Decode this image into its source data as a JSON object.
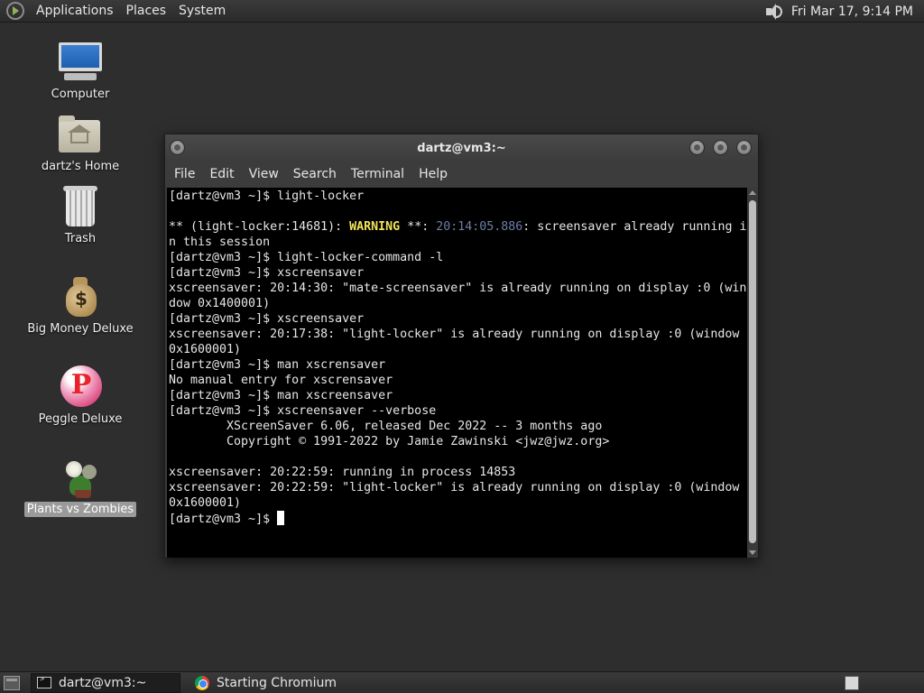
{
  "top_panel": {
    "menus": [
      "Applications",
      "Places",
      "System"
    ],
    "clock": "Fri Mar 17,  9:14 PM"
  },
  "desktop_icons": [
    {
      "label": "Computer",
      "icon": "computer-icon"
    },
    {
      "label": "dartz's Home",
      "icon": "home-folder-icon"
    },
    {
      "label": "Trash",
      "icon": "trash-icon"
    },
    {
      "label": "Big Money Deluxe",
      "icon": "money-bag-icon"
    },
    {
      "label": "Peggle Deluxe",
      "icon": "peggle-icon"
    },
    {
      "label": "Plants vs Zombies",
      "icon": "plants-vs-zombies-icon",
      "selected": true
    }
  ],
  "window": {
    "title": "dartz@vm3:~",
    "menu": [
      "File",
      "Edit",
      "View",
      "Search",
      "Terminal",
      "Help"
    ]
  },
  "terminal": {
    "lines": [
      "[dartz@vm3 ~]$ light-locker",
      "",
      {
        "parts": [
          "** (light-locker:14681): ",
          "WARNING",
          " **: ",
          "20:14:05.886",
          ": screensaver already running i"
        ]
      },
      "n this session",
      "[dartz@vm3 ~]$ light-locker-command -l",
      "[dartz@vm3 ~]$ xscreensaver",
      "xscreensaver: 20:14:30: \"mate-screensaver\" is already running on display :0 (win",
      "dow 0x1400001)",
      "[dartz@vm3 ~]$ xscreensaver",
      "xscreensaver: 20:17:38: \"light-locker\" is already running on display :0 (window",
      "0x1600001)",
      "[dartz@vm3 ~]$ man xscrensaver",
      "No manual entry for xscrensaver",
      "[dartz@vm3 ~]$ man xscreensaver",
      "[dartz@vm3 ~]$ xscreensaver --verbose",
      "        XScreenSaver 6.06, released Dec 2022 -- 3 months ago",
      "        Copyright © 1991-2022 by Jamie Zawinski <jwz@jwz.org>",
      "",
      "xscreensaver: 20:22:59: running in process 14853",
      "xscreensaver: 20:22:59: \"light-locker\" is already running on display :0 (window",
      "0x1600001)"
    ],
    "prompt": "[dartz@vm3 ~]$ "
  },
  "bottom_panel": {
    "tasks": [
      {
        "label": "dartz@vm3:~",
        "icon": "terminal-icon",
        "active": true
      },
      {
        "label": "Starting Chromium",
        "icon": "chromium-icon",
        "active": false
      }
    ]
  },
  "colors": {
    "warning": "#f2e35a",
    "timestamp": "#6d7fa6",
    "selected_label_bg": "#9a9a9a"
  }
}
